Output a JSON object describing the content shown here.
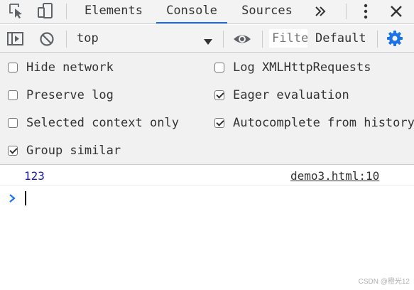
{
  "tabs": [
    {
      "label": "Elements"
    },
    {
      "label": "Console",
      "active": true
    },
    {
      "label": "Sources"
    }
  ],
  "icons": {
    "inspect": "inspect-element-icon",
    "device": "device-toolbar-icon",
    "more_tabs": "chevron-double-right-icon",
    "menu": "vertical-dots-menu-icon",
    "close": "close-icon",
    "sidebar": "console-sidebar-icon",
    "clear": "clear-console-icon",
    "dropdown": "dropdown-arrow-icon",
    "live_expression": "eye-icon",
    "settings": "gear-icon",
    "prompt": "chevron-right-icon"
  },
  "toolbar": {
    "context": "top",
    "filter_placeholder": "Filter",
    "log_level": "Default"
  },
  "settings": {
    "left": [
      {
        "label": "Hide network",
        "checked": false
      },
      {
        "label": "Preserve log",
        "checked": false
      },
      {
        "label": "Selected context only",
        "checked": false
      },
      {
        "label": "Group similar",
        "checked": true
      }
    ],
    "right": [
      {
        "label": "Log XMLHttpRequests",
        "checked": false
      },
      {
        "label": "Eager evaluation",
        "checked": true
      },
      {
        "label": "Autocomplete from history",
        "checked": true
      }
    ]
  },
  "console": {
    "log_value": "123",
    "log_source": "demo3.html:10"
  },
  "watermark": "CSDN @橙光12",
  "colors": {
    "accent": "#1a73e8",
    "settings_gear": "#1a73e8",
    "log_number": "#1a1aa6"
  }
}
